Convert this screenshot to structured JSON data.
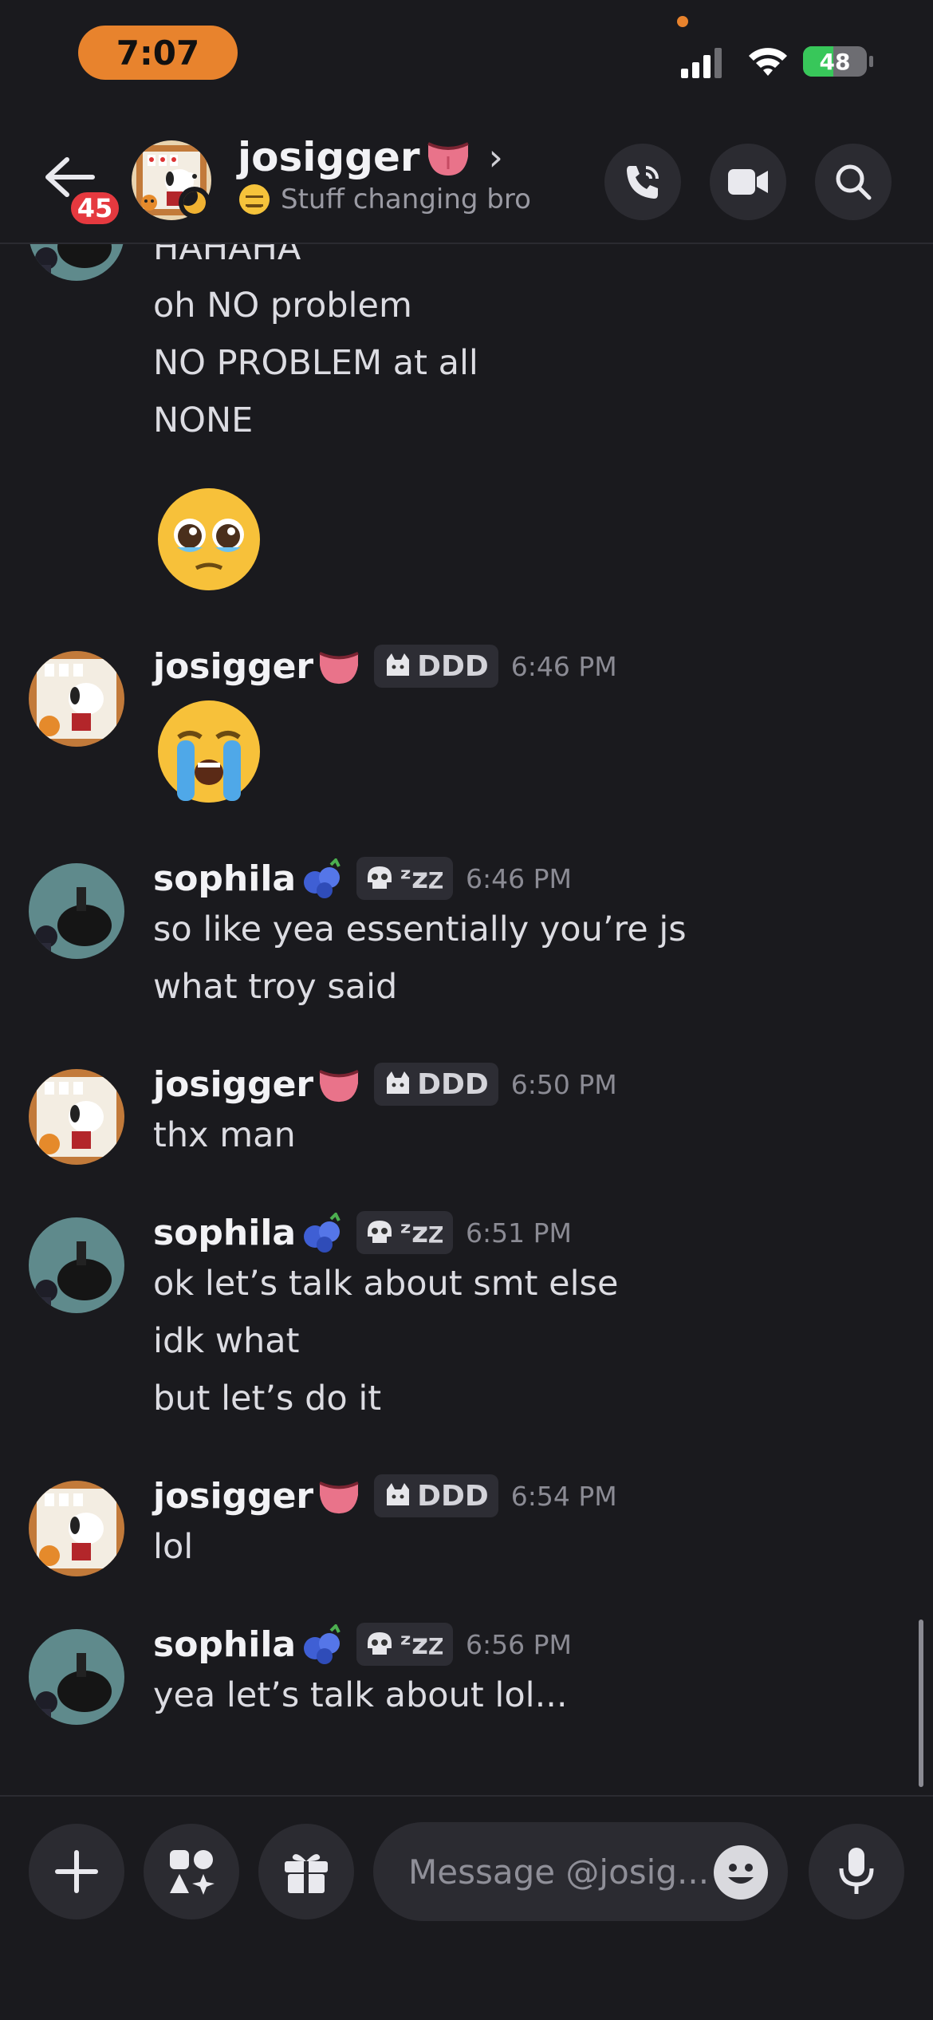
{
  "status_bar": {
    "time": "7:07",
    "battery": "48",
    "battery_level": 0.48
  },
  "header": {
    "back_badge": "45",
    "name": "josigger",
    "chevron": "›",
    "status_text": "Stuff changing bro",
    "icons": [
      "back-arrow-icon",
      "phone-icon",
      "video-camera-icon",
      "search-icon"
    ]
  },
  "messages": {
    "block0": {
      "lines": [
        "HAHAHA",
        "oh NO problem",
        "NO PROBLEM at all",
        "NONE"
      ],
      "emoji": "pleading-face"
    },
    "block1": {
      "user": "josigger",
      "tag": "DDD",
      "time": "6:46 PM",
      "emoji": "loudly-crying-face"
    },
    "block2": {
      "user": "sophila",
      "tag": "ᶻz𝗓",
      "time": "6:46 PM",
      "lines": [
        "so like yea essentially you’re js",
        "what troy said"
      ]
    },
    "block3": {
      "user": "josigger",
      "tag": "DDD",
      "time": "6:50 PM",
      "lines": [
        "thx man"
      ]
    },
    "block4": {
      "user": "sophila",
      "tag": "ᶻz𝗓",
      "time": "6:51 PM",
      "lines": [
        "ok let’s talk about smt else",
        "idk what",
        "but let’s do it"
      ]
    },
    "block5": {
      "user": "josigger",
      "tag": "DDD",
      "time": "6:54 PM",
      "lines": [
        "lol"
      ]
    },
    "block6": {
      "user": "sophila",
      "tag": "ᶻz𝗓",
      "time": "6:56 PM",
      "lines": [
        "yea let’s talk about lol..."
      ]
    }
  },
  "input": {
    "placeholder": "Message @josig...",
    "icons": [
      "plus-icon",
      "apps-icon",
      "gift-icon",
      "emoji-icon",
      "microphone-icon"
    ]
  },
  "colors": {
    "background": "#1a1a1e",
    "surface": "#2b2b31",
    "badge": "#e5393f",
    "status_pill": "#e8832d",
    "battery_green": "#38c75a"
  }
}
